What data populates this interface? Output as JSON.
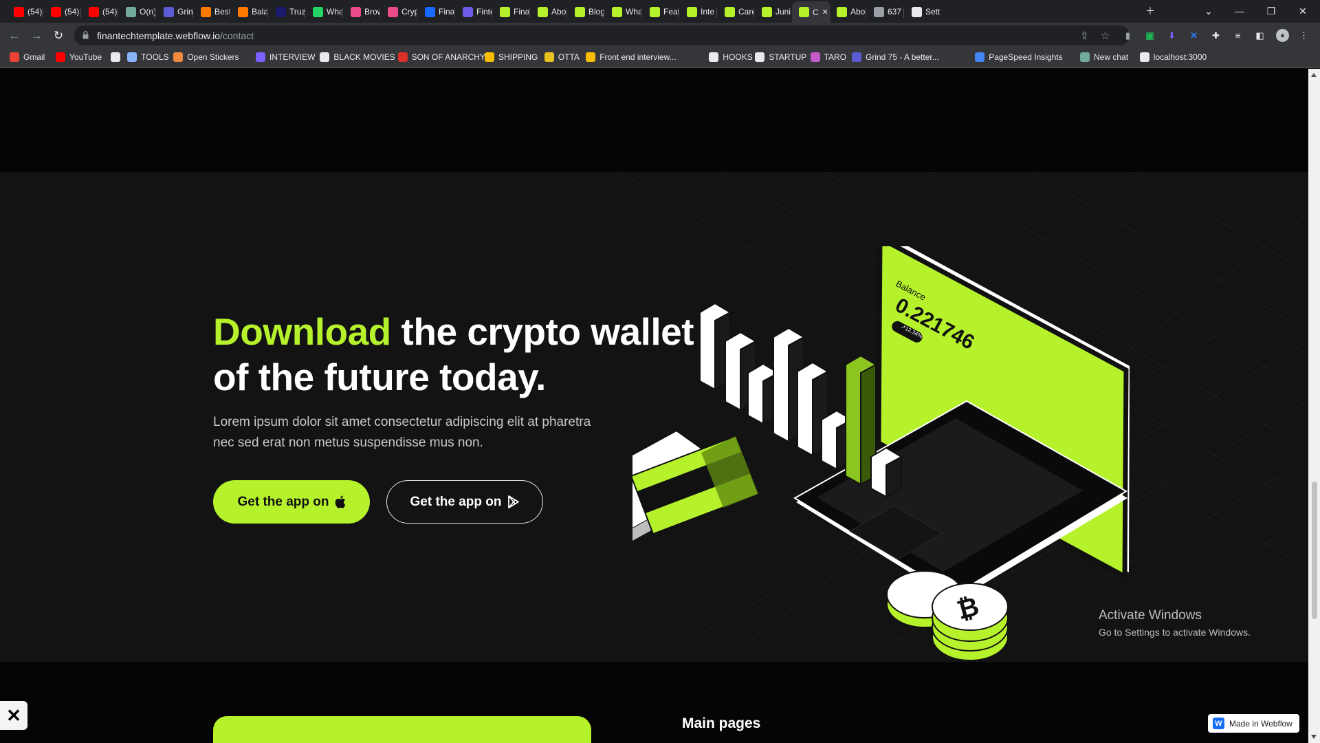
{
  "browser": {
    "tabs": [
      {
        "label": "(54)",
        "icon": "youtube-icon",
        "color": "#ff0000"
      },
      {
        "label": "(54)",
        "icon": "youtube-icon",
        "color": "#ff0000"
      },
      {
        "label": "(54)",
        "icon": "youtube-icon",
        "color": "#ff0000"
      },
      {
        "label": "O(n)",
        "icon": "openai-icon",
        "color": "#74aa9c"
      },
      {
        "label": "Grin",
        "icon": "grind75-icon",
        "color": "#5b5bd6"
      },
      {
        "label": "Best",
        "icon": "blog-icon",
        "color": "#ff7a00"
      },
      {
        "label": "Bala",
        "icon": "blog-icon",
        "color": "#ff7a00"
      },
      {
        "label": "Truz",
        "icon": "truz-icon",
        "color": "#1a1a6e"
      },
      {
        "label": "Wha",
        "icon": "whatsapp-icon",
        "color": "#25d366"
      },
      {
        "label": "Brow",
        "icon": "dribbble-icon",
        "color": "#ea4c89"
      },
      {
        "label": "Cryp",
        "icon": "dribbble-icon",
        "color": "#ea4c89"
      },
      {
        "label": "Fina",
        "icon": "behance-icon",
        "color": "#1769ff"
      },
      {
        "label": "Finte",
        "icon": "dots-icon",
        "color": "#6c5ce7"
      },
      {
        "label": "Fina",
        "icon": "finantech-icon",
        "color": "#b6f22c"
      },
      {
        "label": "Abo",
        "icon": "finantech-icon",
        "color": "#b6f22c"
      },
      {
        "label": "Blog",
        "icon": "finantech-icon",
        "color": "#b6f22c"
      },
      {
        "label": "Wha",
        "icon": "finantech-icon",
        "color": "#b6f22c"
      },
      {
        "label": "Feat",
        "icon": "finantech-icon",
        "color": "#b6f22c"
      },
      {
        "label": "Inte",
        "icon": "finantech-icon",
        "color": "#b6f22c"
      },
      {
        "label": "Care",
        "icon": "finantech-icon",
        "color": "#b6f22c"
      },
      {
        "label": "Juni",
        "icon": "finantech-icon",
        "color": "#b6f22c"
      },
      {
        "label": "C",
        "icon": "finantech-icon",
        "color": "#b6f22c"
      },
      {
        "label": "Abo",
        "icon": "finantech-icon",
        "color": "#b6f22c"
      },
      {
        "label": "637",
        "icon": "globe-icon",
        "color": "#9aa0a6"
      },
      {
        "label": "Setti",
        "icon": "gear-icon",
        "color": "#e8eaed"
      }
    ],
    "active_tab_index": 21,
    "url_domain": "finantechtemplate.webflow.io",
    "url_path": "/contact",
    "bookmarks": [
      {
        "label": "Gmail",
        "icon": "gmail-icon",
        "color": "#ea4335"
      },
      {
        "label": "YouTube",
        "icon": "youtube-icon",
        "color": "#ff0000"
      },
      {
        "label": "",
        "icon": "globe-icon",
        "color": "#e8eaed"
      },
      {
        "label": "TOOLS",
        "icon": "link-icon",
        "color": "#8ab4f8"
      },
      {
        "label": "Open Stickers",
        "icon": "sticker-icon",
        "color": "#f0883e"
      },
      {
        "label": "INTERVIEW",
        "icon": "interview-icon",
        "color": "#7b61ff"
      },
      {
        "label": "BLACK MOVIES",
        "icon": "globe-icon",
        "color": "#e8eaed"
      },
      {
        "label": "SON OF ANARCHY",
        "icon": "flag-icon",
        "color": "#d93025"
      },
      {
        "label": "SHIPPING",
        "icon": "chevrons-icon",
        "color": "#fbbc04"
      },
      {
        "label": "OTTA",
        "icon": "otta-icon",
        "color": "#e9c320"
      },
      {
        "label": "Front end interview...",
        "icon": "bookmark-icon",
        "color": "#fbbc04"
      },
      {
        "label": "HOOKS",
        "icon": "hooks-icon",
        "color": "#e8eaed"
      },
      {
        "label": "STARTUP",
        "icon": "list-icon",
        "color": "#e8eaed"
      },
      {
        "label": "TARO",
        "icon": "taro-icon",
        "color": "#c45ac8"
      },
      {
        "label": "Grind 75 - A better...",
        "icon": "grind75-icon",
        "color": "#5b5bd6"
      },
      {
        "label": "PageSpeed Insights",
        "icon": "pagespeed-icon",
        "color": "#4285f4"
      },
      {
        "label": "New chat",
        "icon": "openai-icon",
        "color": "#74aa9c"
      },
      {
        "label": "localhost:3000",
        "icon": "vercel-icon",
        "color": "#e8eaed"
      }
    ]
  },
  "hero": {
    "title_accent": "Download",
    "title_rest": " the crypto wallet of the future today.",
    "description": "Lorem ipsum dolor sit amet consectetur adipiscing elit at pharetra nec sed erat non metus suspendisse mus non.",
    "primary_button_label": "Get the app on",
    "secondary_button_label": "Get the app on",
    "illustration": {
      "balance_label": "Balance",
      "balance_value": "0.221746",
      "change": "↗12.34%"
    }
  },
  "footer": {
    "heading": "Main pages"
  },
  "windows_watermark": {
    "title": "Activate Windows",
    "subtitle": "Go to Settings to activate Windows."
  },
  "badge": {
    "label": "Made in Webflow"
  },
  "colors": {
    "accent": "#b6f22c",
    "background": "#131313",
    "chrome": "#35363a"
  }
}
